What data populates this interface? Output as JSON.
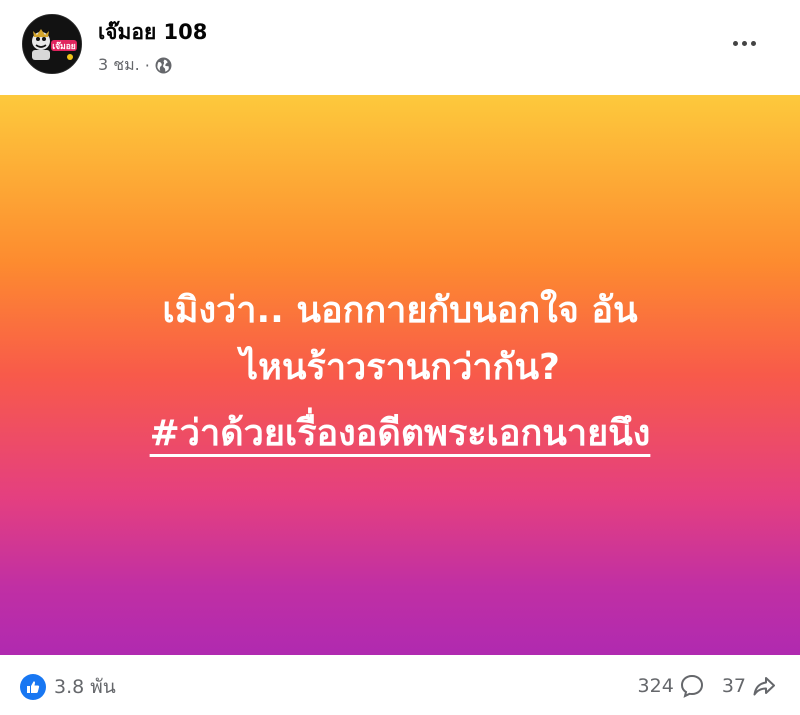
{
  "post": {
    "author": {
      "name": "เจ๊มอย 108",
      "avatar_text": "เจ๊มอย"
    },
    "meta": {
      "time": "3 ชม.",
      "separator": "·",
      "audience_icon": "globe-icon"
    },
    "content": {
      "background_colors": [
        "#fdc93c",
        "#fd8b2f",
        "#f85a4a",
        "#e43f80",
        "#b02ab0"
      ],
      "text_color": "#ffffff",
      "message_line1": "เมิงว่า.. นอกกายกับนอกใจ อัน",
      "message_line2": "ไหนร้าวรานกว่ากัน?",
      "hashtag": "#ว่าด้วยเรื่องอดีตพระเอกนายนึง"
    },
    "footer": {
      "reaction_icon": "like-icon",
      "reaction_color": "#1877f2",
      "reaction_count": "3.8 พัน",
      "comments_count": "324",
      "comment_icon": "comment-icon",
      "shares_count": "37",
      "share_icon": "share-icon"
    }
  }
}
